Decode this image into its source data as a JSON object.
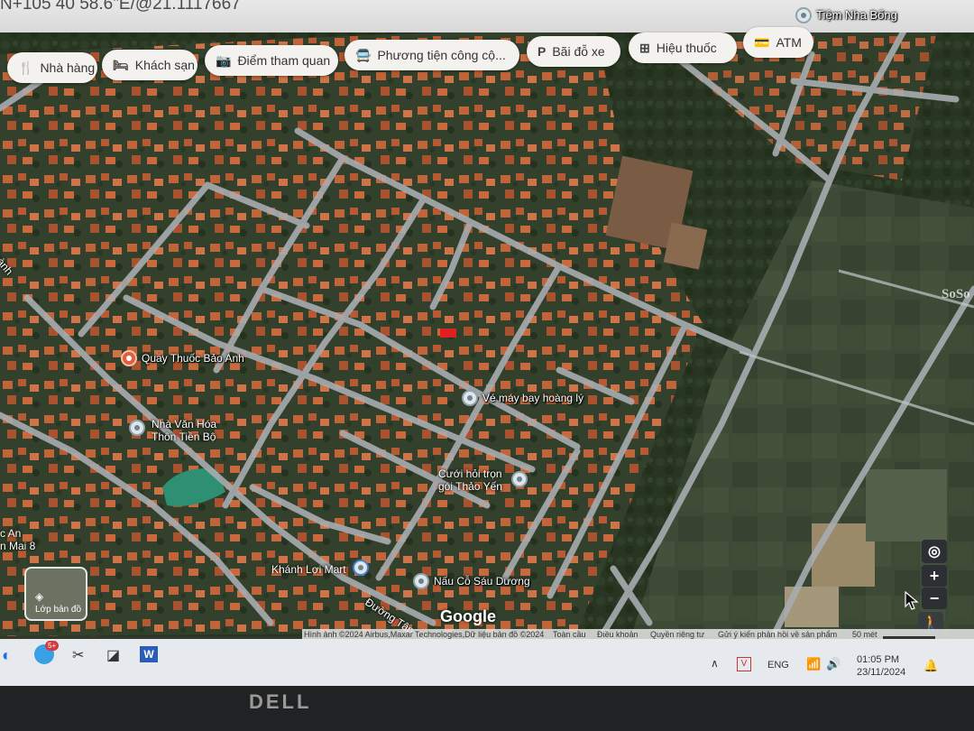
{
  "browser": {
    "address_text": "N+105 40 58.6\"E/@21.1117667"
  },
  "chips": [
    {
      "icon": "🍴",
      "icon_name": "restaurant-icon",
      "label": "Nhà hàng"
    },
    {
      "icon": "🛏",
      "icon_name": "hotel-icon",
      "label": "Khách sạn"
    },
    {
      "icon": "📷",
      "icon_name": "camera-icon",
      "label": "Điểm tham quan"
    },
    {
      "icon": "🚍",
      "icon_name": "transit-icon",
      "label": "Phương tiện công cộ..."
    },
    {
      "icon": "P",
      "icon_name": "parking-icon",
      "label": "Bãi đỗ xe"
    },
    {
      "icon": "⊞",
      "icon_name": "pharmacy-icon",
      "label": "Hiệu thuốc"
    },
    {
      "icon": "💳",
      "icon_name": "atm-icon",
      "label": "ATM"
    }
  ],
  "places": {
    "tiem_nha_bong": "Tiệm Nha Bống",
    "quay_thuoc": "Quầy Thuốc Bảo Anh",
    "ve_may_bay": "Vé máy bay hoàng lý",
    "nha_van_hoa_1": "Nhà Văn Hóa",
    "nha_van_hoa_2": "Thôn Tiền Bộ",
    "cuoi_hoi_1": "Cưới hỏi trọn",
    "cuoi_hoi_2": "gói Thảo Yến",
    "khanh_loi": "Khánh Lợi Mart",
    "nau_co": "Nấu Cỗ Sáu Dương",
    "duong_tan_thanh": "Đường Tân Thành",
    "left_edge_1": "hành",
    "left_edge_2": "c An",
    "left_edge_3": "n Mai 8"
  },
  "map_ui": {
    "layer_label": "Lớp bản đồ",
    "google_logo": "Google",
    "zoom_in": "+",
    "zoom_out": "−",
    "watermark": "SoSo"
  },
  "attribution": {
    "imagery": "Hình ảnh ©2024 Airbus,Maxar Technologies,Dữ liệu bản đồ ©2024",
    "global": "Toàn cầu",
    "terms": "Điều khoản",
    "privacy": "Quyền riêng tư",
    "feedback": "Gửi ý kiến phản hồi về sản phẩm",
    "scale": "50 mét"
  },
  "taskbar": {
    "badge": "5+",
    "language": "ENG",
    "time": "01:05 PM",
    "date": "23/11/2024"
  },
  "monitor": {
    "brand": "DELL"
  },
  "colors": {
    "chip_bg": "#f4f2ee",
    "road": "#a8acb0",
    "roof": "#c0643a",
    "vegetation": "#2d3a27",
    "taskbar": "#e6e9ee"
  }
}
